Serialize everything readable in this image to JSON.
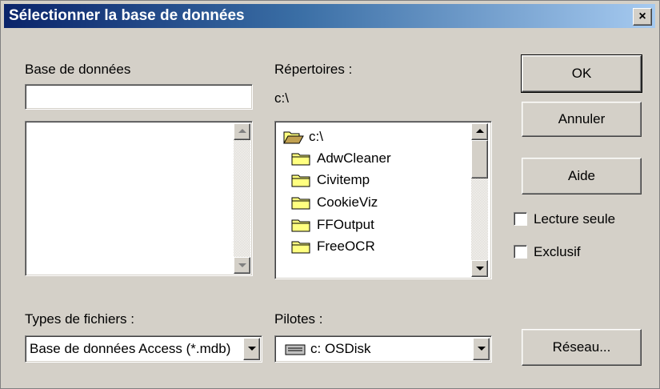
{
  "dialog": {
    "title": "Sélectionner la base de données",
    "close_glyph": "×"
  },
  "database": {
    "label": "Base de données",
    "value": ""
  },
  "directories": {
    "label": "Répertoires :",
    "current_path": "c:\\",
    "items": [
      {
        "name": "c:\\",
        "icon": "open-folder-icon"
      },
      {
        "name": "AdwCleaner",
        "icon": "folder-icon"
      },
      {
        "name": "Civitemp",
        "icon": "folder-icon"
      },
      {
        "name": "CookieViz",
        "icon": "folder-icon"
      },
      {
        "name": "FFOutput",
        "icon": "folder-icon"
      },
      {
        "name": "FreeOCR",
        "icon": "folder-icon"
      }
    ]
  },
  "buttons": {
    "ok": "OK",
    "cancel": "Annuler",
    "help": "Aide",
    "network": "Réseau..."
  },
  "options": {
    "read_only": {
      "label": "Lecture seule",
      "checked": false
    },
    "exclusive": {
      "label": "Exclusif",
      "checked": false
    }
  },
  "file_types": {
    "label": "Types de fichiers :",
    "selected": "Base de données Access (*.mdb)"
  },
  "drives": {
    "label": "Pilotes :",
    "selected": "c: OSDisk",
    "icon": "drive-icon"
  },
  "colors": {
    "titlebar_start": "#0a246a",
    "titlebar_end": "#a6caf0",
    "face": "#d4d0c8",
    "folder_fill": "#ffff80"
  }
}
